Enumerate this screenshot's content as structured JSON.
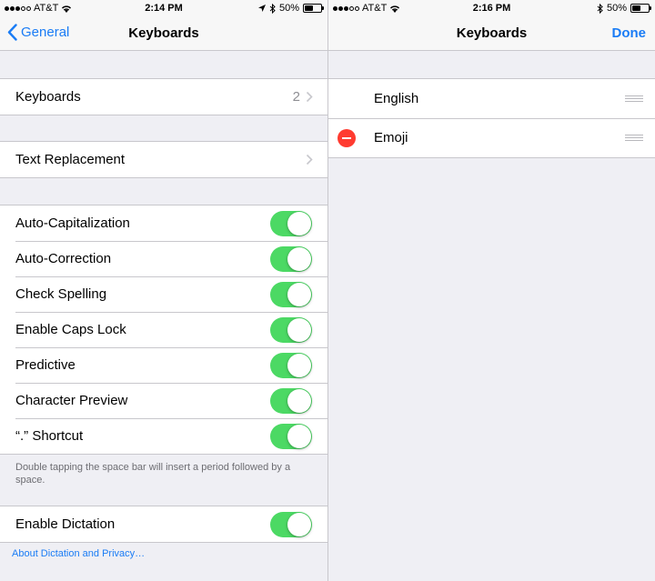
{
  "left": {
    "status": {
      "carrier": "AT&T",
      "time": "2:14 PM",
      "battery": "50%",
      "battery_level": 0.5
    },
    "nav": {
      "back_label": "General",
      "title": "Keyboards"
    },
    "keyboards_row": {
      "label": "Keyboards",
      "count": "2"
    },
    "text_replacement": {
      "label": "Text Replacement"
    },
    "toggles": [
      {
        "label": "Auto-Capitalization",
        "on": true
      },
      {
        "label": "Auto-Correction",
        "on": true
      },
      {
        "label": "Check Spelling",
        "on": true
      },
      {
        "label": "Enable Caps Lock",
        "on": true
      },
      {
        "label": "Predictive",
        "on": true
      },
      {
        "label": "Character Preview",
        "on": true
      },
      {
        "label": "“.” Shortcut",
        "on": true
      }
    ],
    "shortcut_footnote": "Double tapping the space bar will insert a period followed by a space.",
    "dictation": {
      "label": "Enable Dictation",
      "on": true
    },
    "dictation_link": "About Dictation and Privacy…"
  },
  "right": {
    "status": {
      "carrier": "AT&T",
      "time": "2:16 PM",
      "battery": "50%",
      "battery_level": 0.5
    },
    "nav": {
      "title": "Keyboards",
      "done_label": "Done"
    },
    "keyboards": [
      {
        "label": "English",
        "deletable": false
      },
      {
        "label": "Emoji",
        "deletable": true
      }
    ]
  },
  "colors": {
    "accent": "#1a7cf5",
    "toggle_on": "#4cd964",
    "delete": "#ff3b30",
    "background": "#efeff4"
  },
  "icons": [
    "chevron-left-icon",
    "chevron-right-icon",
    "wifi-icon",
    "location-icon",
    "bluetooth-icon",
    "battery-icon",
    "delete-icon",
    "reorder-icon"
  ]
}
